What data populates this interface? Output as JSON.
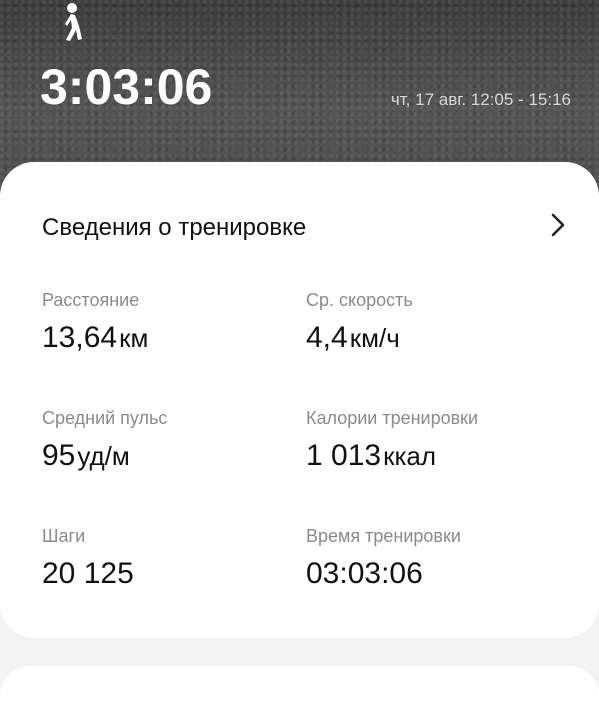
{
  "header": {
    "icon": "walking-person-icon",
    "duration": "3:03:06",
    "date_range": "чт, 17 авг. 12:05 - 15:16"
  },
  "card": {
    "title": "Сведения о тренировке",
    "stats": {
      "distance": {
        "label": "Расстояние",
        "value": "13,64",
        "unit": "км"
      },
      "speed": {
        "label": "Ср. скорость",
        "value": "4,4",
        "unit": "км/ч"
      },
      "heart_rate": {
        "label": "Средний пульс",
        "value": "95",
        "unit": "уд/м"
      },
      "calories": {
        "label": "Калории тренировки",
        "value": "1 013",
        "unit": "ккал"
      },
      "steps": {
        "label": "Шаги",
        "value": "20 125",
        "unit": ""
      },
      "time": {
        "label": "Время тренировки",
        "value": "03:03:06",
        "unit": ""
      }
    }
  },
  "colors": {
    "hero_bg": "#4a4a4a",
    "card_bg": "#ffffff",
    "label": "#8a8a8a"
  }
}
